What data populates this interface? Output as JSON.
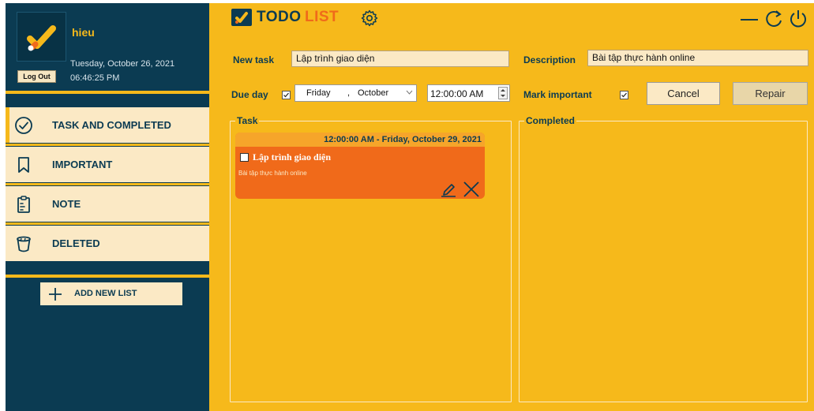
{
  "user": {
    "name": "hieu",
    "date": "Tuesday, October 26, 2021",
    "time": "06:46:25 PM",
    "logout_label": "Log Out"
  },
  "nav": {
    "items": [
      {
        "label": "TASK AND COMPLETED",
        "icon": "check-circle-icon",
        "active": true
      },
      {
        "label": "IMPORTANT",
        "icon": "bookmark-icon",
        "active": false
      },
      {
        "label": "NOTE",
        "icon": "clipboard-icon",
        "active": false
      },
      {
        "label": "DELETED",
        "icon": "trash-icon",
        "active": false
      }
    ],
    "add_list_label": "ADD NEW LIST"
  },
  "brand": {
    "todo": "TODO",
    "list": "LIST"
  },
  "form": {
    "new_task_label": "New task",
    "new_task_value": "Lập trình giao diện",
    "description_label": "Description",
    "description_value": "Bài tập thực hành online",
    "due_day_label": "Due day",
    "due_day_checked": true,
    "date_day": "Friday",
    "date_sep": ",",
    "date_month": "October",
    "time_value": "12:00:00 AM",
    "mark_important_label": "Mark important",
    "mark_important_checked": true,
    "cancel_label": "Cancel",
    "repair_label": "Repair"
  },
  "groups": {
    "task_label": "Task",
    "completed_label": "Completed"
  },
  "tasks": [
    {
      "datetime": "12:00:00 AM - Friday, October 29, 2021",
      "title": "Lập trình giao diện",
      "description": "Bài tập thực hành online",
      "done": false
    }
  ],
  "colors": {
    "sidebar": "#0b3b52",
    "accent": "#f6b91b",
    "panel": "#fbe9c5",
    "card": "#f06a1a",
    "brand_list": "#f06a1a"
  }
}
